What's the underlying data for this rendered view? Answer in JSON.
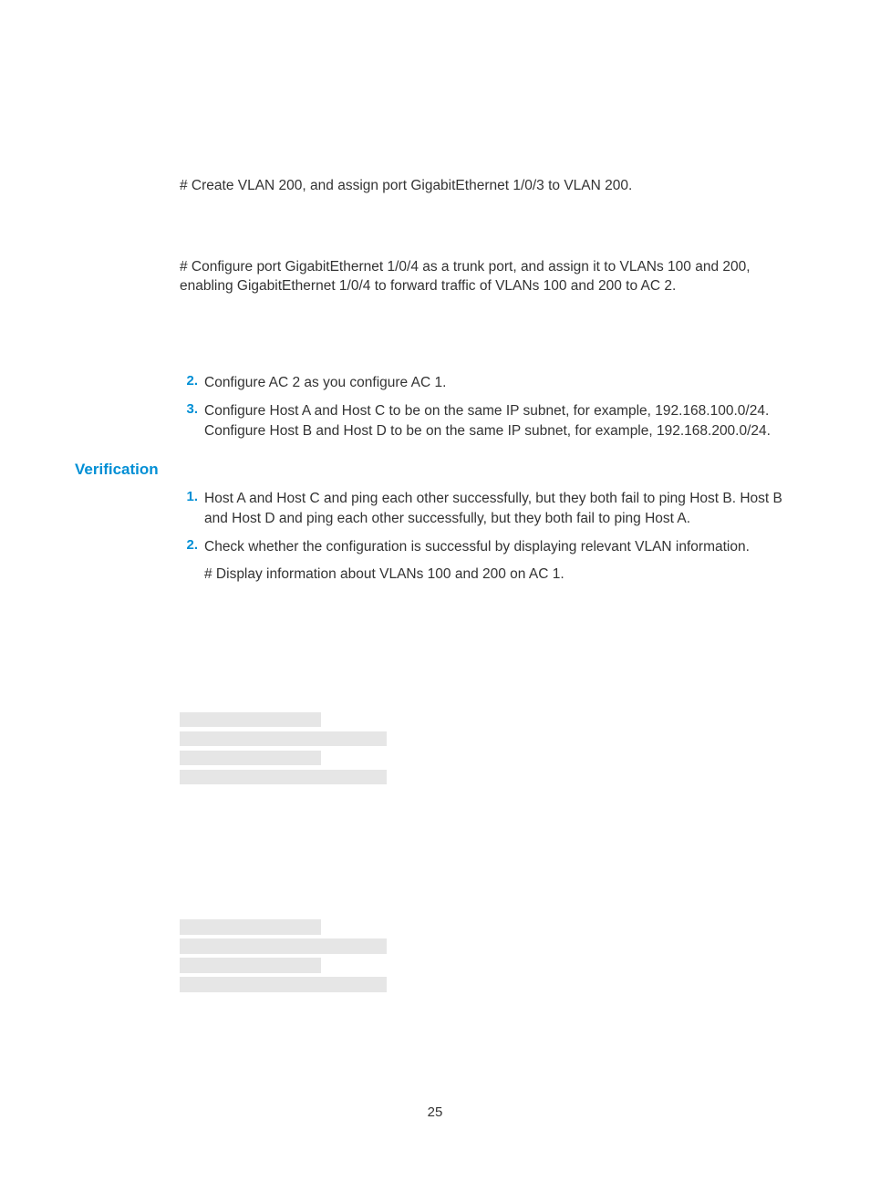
{
  "p1": "# Create VLAN 200, and assign port GigabitEthernet 1/0/3 to VLAN 200.",
  "p2": "# Configure port GigabitEthernet 1/0/4 as a trunk port, and assign it to VLANs 100 and 200, enabling GigabitEthernet 1/0/4 to forward traffic of VLANs 100 and 200 to AC 2.",
  "list1": {
    "items": [
      {
        "num": "2.",
        "text": "Configure AC 2 as you configure AC 1."
      },
      {
        "num": "3.",
        "text": "Configure Host A and Host C to be on the same IP subnet, for example, 192.168.100.0/24. Configure Host B and Host D to be on the same IP subnet, for example, 192.168.200.0/24."
      }
    ]
  },
  "heading": "Verification",
  "list2": {
    "items": [
      {
        "num": "1.",
        "text": "Host A and Host C and ping each other successfully, but they both fail to ping Host B. Host B and Host D and ping each other successfully, but they both fail to ping Host A."
      },
      {
        "num": "2.",
        "text": "Check whether the configuration is successful by displaying relevant VLAN information.",
        "sub": "# Display information about VLANs 100 and 200 on AC 1."
      }
    ]
  },
  "pageNumber": "25"
}
